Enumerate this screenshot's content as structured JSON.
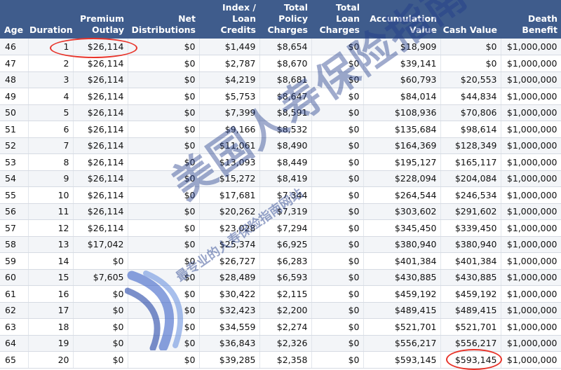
{
  "columns": [
    "Age",
    "Duration",
    "Premium Outlay",
    "Net Distributions",
    "Index / Loan Credits",
    "Total Policy Charges",
    "Total Loan Charges",
    "Accumulation Value",
    "Cash Value",
    "Death Benefit"
  ],
  "rows": [
    [
      "46",
      "1",
      "$26,114",
      "$0",
      "$1,449",
      "$8,654",
      "$0",
      "$18,909",
      "$0",
      "$1,000,000"
    ],
    [
      "47",
      "2",
      "$26,114",
      "$0",
      "$2,787",
      "$8,670",
      "$0",
      "$39,141",
      "$0",
      "$1,000,000"
    ],
    [
      "48",
      "3",
      "$26,114",
      "$0",
      "$4,219",
      "$8,681",
      "$0",
      "$60,793",
      "$20,553",
      "$1,000,000"
    ],
    [
      "49",
      "4",
      "$26,114",
      "$0",
      "$5,753",
      "$8,647",
      "$0",
      "$84,014",
      "$44,834",
      "$1,000,000"
    ],
    [
      "50",
      "5",
      "$26,114",
      "$0",
      "$7,399",
      "$8,591",
      "$0",
      "$108,936",
      "$70,806",
      "$1,000,000"
    ],
    [
      "51",
      "6",
      "$26,114",
      "$0",
      "$9,166",
      "$8,532",
      "$0",
      "$135,684",
      "$98,614",
      "$1,000,000"
    ],
    [
      "52",
      "7",
      "$26,114",
      "$0",
      "$11,061",
      "$8,490",
      "$0",
      "$164,369",
      "$128,349",
      "$1,000,000"
    ],
    [
      "53",
      "8",
      "$26,114",
      "$0",
      "$13,093",
      "$8,449",
      "$0",
      "$195,127",
      "$165,117",
      "$1,000,000"
    ],
    [
      "54",
      "9",
      "$26,114",
      "$0",
      "$15,272",
      "$8,419",
      "$0",
      "$228,094",
      "$204,084",
      "$1,000,000"
    ],
    [
      "55",
      "10",
      "$26,114",
      "$0",
      "$17,681",
      "$7,344",
      "$0",
      "$264,544",
      "$246,534",
      "$1,000,000"
    ],
    [
      "56",
      "11",
      "$26,114",
      "$0",
      "$20,262",
      "$7,319",
      "$0",
      "$303,602",
      "$291,602",
      "$1,000,000"
    ],
    [
      "57",
      "12",
      "$26,114",
      "$0",
      "$23,028",
      "$7,294",
      "$0",
      "$345,450",
      "$339,450",
      "$1,000,000"
    ],
    [
      "58",
      "13",
      "$17,042",
      "$0",
      "$25,374",
      "$6,925",
      "$0",
      "$380,940",
      "$380,940",
      "$1,000,000"
    ],
    [
      "59",
      "14",
      "$0",
      "$0",
      "$26,727",
      "$6,283",
      "$0",
      "$401,384",
      "$401,384",
      "$1,000,000"
    ],
    [
      "60",
      "15",
      "$7,605",
      "$0",
      "$28,489",
      "$6,593",
      "$0",
      "$430,885",
      "$430,885",
      "$1,000,000"
    ],
    [
      "61",
      "16",
      "$0",
      "$0",
      "$30,422",
      "$2,115",
      "$0",
      "$459,192",
      "$459,192",
      "$1,000,000"
    ],
    [
      "62",
      "17",
      "$0",
      "$0",
      "$32,423",
      "$2,200",
      "$0",
      "$489,415",
      "$489,415",
      "$1,000,000"
    ],
    [
      "63",
      "18",
      "$0",
      "$0",
      "$34,559",
      "$2,274",
      "$0",
      "$521,701",
      "$521,701",
      "$1,000,000"
    ],
    [
      "64",
      "19",
      "$0",
      "$0",
      "$36,843",
      "$2,326",
      "$0",
      "$556,217",
      "$556,217",
      "$1,000,000"
    ],
    [
      "65",
      "20",
      "$0",
      "$0",
      "$39,285",
      "$2,358",
      "$0",
      "$593,145",
      "$593,145",
      "$1,000,000"
    ]
  ],
  "watermark": {
    "main": "美国人寿保险指南",
    "sub": "最专业的人寿保险指南网站",
    "color": "#1f3a8a"
  },
  "colors": {
    "header_bg": "#3f5c8c",
    "header_text": "#ffffff",
    "highlight": "#e8342a"
  },
  "highlights": [
    {
      "row": 0,
      "column": "Premium Outlay"
    },
    {
      "row": 19,
      "column": "Cash Value"
    }
  ]
}
